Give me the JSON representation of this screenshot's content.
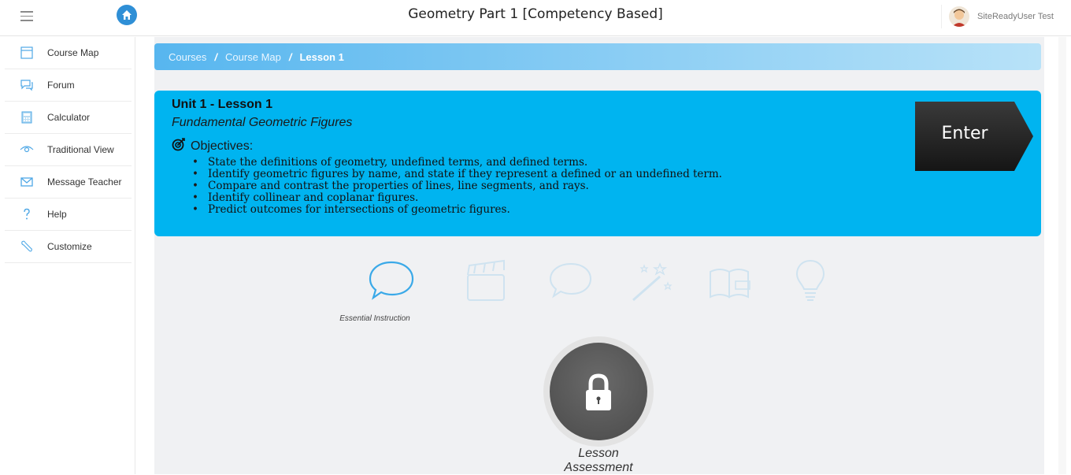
{
  "topbar": {
    "title": "Geometry Part 1 [Competency Based]",
    "user_name": "SiteReadyUser Test"
  },
  "sidebar": {
    "items": [
      {
        "label": "Course Map",
        "icon": "course-map-icon"
      },
      {
        "label": "Forum",
        "icon": "forum-icon"
      },
      {
        "label": "Calculator",
        "icon": "calculator-icon"
      },
      {
        "label": "Traditional View",
        "icon": "eye-icon"
      },
      {
        "label": "Message Teacher",
        "icon": "envelope-icon"
      },
      {
        "label": "Help",
        "icon": "question-icon"
      },
      {
        "label": "Customize",
        "icon": "wrench-icon"
      }
    ]
  },
  "breadcrumb": {
    "items": [
      "Courses",
      "Course Map",
      "Lesson 1"
    ],
    "separator": "/"
  },
  "lesson": {
    "unit_title": "Unit 1 - Lesson 1",
    "subtitle": "Fundamental Geometric Figures",
    "objectives_heading": "Objectives:",
    "objectives": [
      "State the definitions of geometry, undefined terms, and defined terms.",
      "Identify geometric figures by name, and state if they represent a defined or an undefined term.",
      "Compare and contrast the properties of lines, line segments, and rays.",
      "Identify collinear and coplanar figures.",
      "Predict outcomes for intersections of geometric figures."
    ],
    "enter_label": "Enter"
  },
  "activities": {
    "active_label": "Essential Instruction",
    "icons": [
      "speech-bubble-icon",
      "clapperboard-icon",
      "speech-bubble-icon",
      "magic-wand-icon",
      "book-icon",
      "lightbulb-icon"
    ]
  },
  "assessment": {
    "label_line1": "Lesson",
    "label_line2": "Assessment",
    "icon": "lock-icon"
  },
  "colors": {
    "lesson_card": "#00b4f0",
    "breadcrumb_start": "#57b6ef",
    "breadcrumb_end": "#b8e2f8",
    "active_icon": "#3aa9e8",
    "inactive_icon": "#cfe3f0"
  }
}
